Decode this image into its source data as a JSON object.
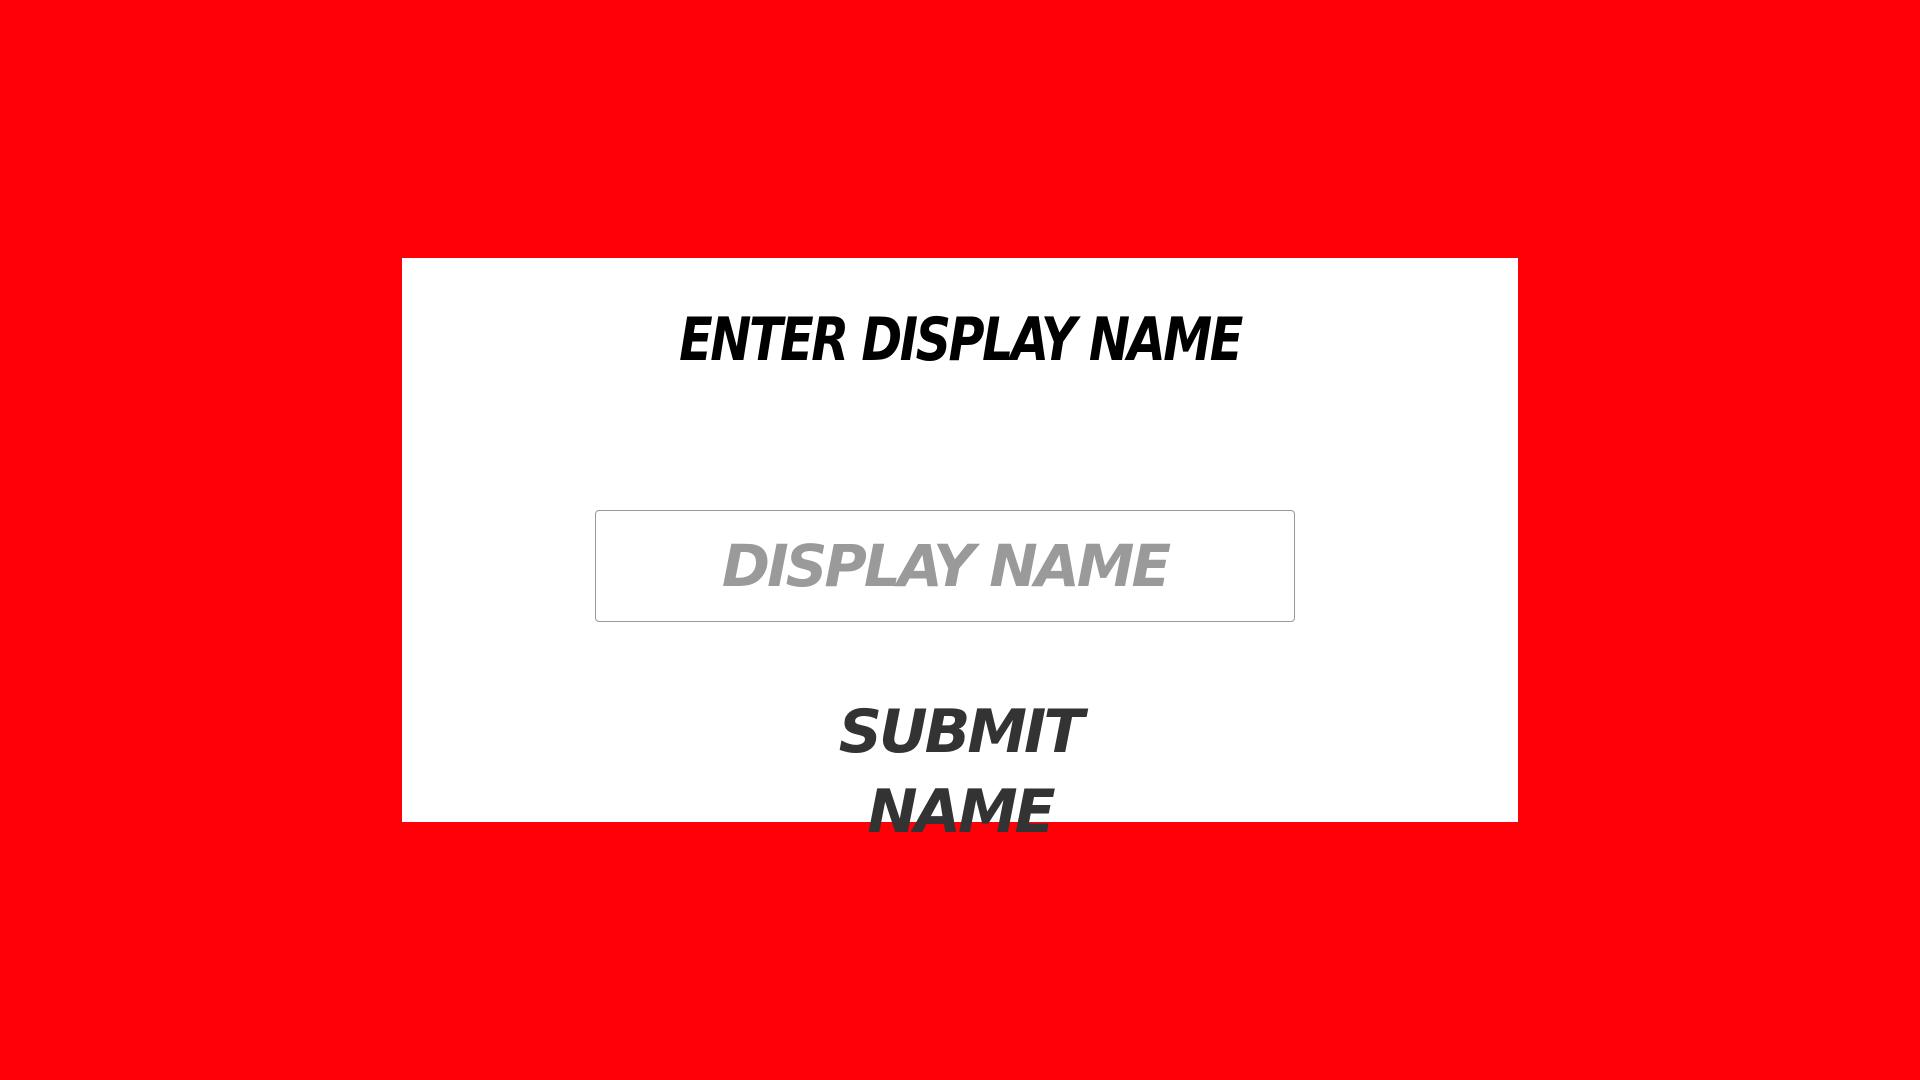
{
  "colors": {
    "background": "#ff0008",
    "card": "#ffffff",
    "title_text": "#000000",
    "placeholder_text": "#9a9a9a",
    "button_text": "#333333",
    "input_border": "#9a9a9a"
  },
  "form": {
    "title": "Enter Display Name",
    "input": {
      "placeholder": "Display Name",
      "value": ""
    },
    "submit_label": "Submit Name"
  }
}
